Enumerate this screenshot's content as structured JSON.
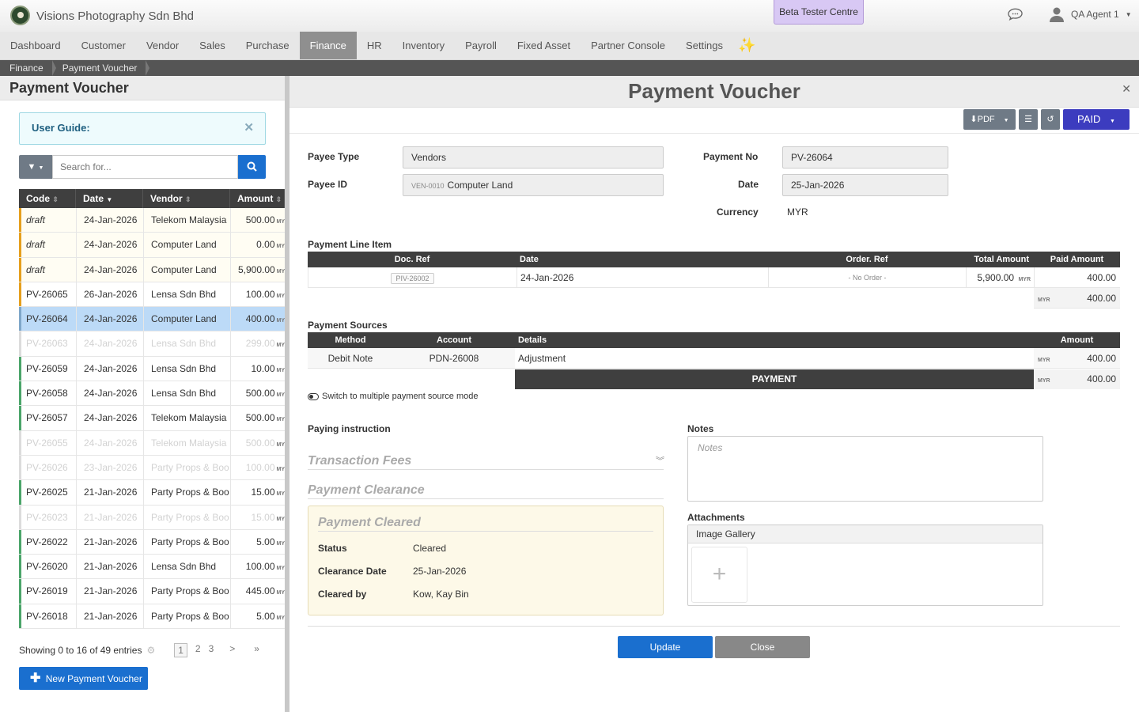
{
  "app": {
    "company": "Visions Photography Sdn Bhd",
    "beta": "Beta Tester Centre",
    "user": "QA Agent 1"
  },
  "nav": [
    "Dashboard",
    "Customer",
    "Vendor",
    "Sales",
    "Purchase",
    "Finance",
    "HR",
    "Inventory",
    "Payroll",
    "Fixed Asset",
    "Partner Console",
    "Settings"
  ],
  "nav_active": "Finance",
  "breadcrumb": [
    "Finance",
    "Payment Voucher"
  ],
  "list": {
    "title": "Payment Voucher",
    "guide": "User Guide:",
    "search_placeholder": "Search for...",
    "columns": [
      "Code",
      "Date",
      "Vendor",
      "Amount"
    ],
    "rows": [
      {
        "code": "draft",
        "date": "24-Jan-2026",
        "vendor": "Telekom Malaysia",
        "amount": "500.00",
        "state": "draft"
      },
      {
        "code": "draft",
        "date": "24-Jan-2026",
        "vendor": "Computer Land",
        "amount": "0.00",
        "state": "draft"
      },
      {
        "code": "draft",
        "date": "24-Jan-2026",
        "vendor": "Computer Land",
        "amount": "5,900.00",
        "state": "draft"
      },
      {
        "code": "PV-26065",
        "date": "26-Jan-2026",
        "vendor": "Lensa Sdn Bhd",
        "amount": "100.00",
        "state": "open"
      },
      {
        "code": "PV-26064",
        "date": "24-Jan-2026",
        "vendor": "Computer Land",
        "amount": "400.00",
        "state": "sel"
      },
      {
        "code": "PV-26063",
        "date": "24-Jan-2026",
        "vendor": "Lensa Sdn Bhd",
        "amount": "299.00",
        "state": "void"
      },
      {
        "code": "PV-26059",
        "date": "24-Jan-2026",
        "vendor": "Lensa Sdn Bhd",
        "amount": "10.00",
        "state": "green"
      },
      {
        "code": "PV-26058",
        "date": "24-Jan-2026",
        "vendor": "Lensa Sdn Bhd",
        "amount": "500.00",
        "state": "green"
      },
      {
        "code": "PV-26057",
        "date": "24-Jan-2026",
        "vendor": "Telekom Malaysia",
        "amount": "500.00",
        "state": "green"
      },
      {
        "code": "PV-26055",
        "date": "24-Jan-2026",
        "vendor": "Telekom Malaysia",
        "amount": "500.00",
        "state": "void"
      },
      {
        "code": "PV-26026",
        "date": "23-Jan-2026",
        "vendor": "Party Props & Boo",
        "amount": "100.00",
        "state": "void"
      },
      {
        "code": "PV-26025",
        "date": "21-Jan-2026",
        "vendor": "Party Props & Boo",
        "amount": "15.00",
        "state": "green"
      },
      {
        "code": "PV-26023",
        "date": "21-Jan-2026",
        "vendor": "Party Props & Boo",
        "amount": "15.00",
        "state": "void"
      },
      {
        "code": "PV-26022",
        "date": "21-Jan-2026",
        "vendor": "Party Props & Boo",
        "amount": "5.00",
        "state": "green"
      },
      {
        "code": "PV-26020",
        "date": "21-Jan-2026",
        "vendor": "Lensa Sdn Bhd",
        "amount": "100.00",
        "state": "green"
      },
      {
        "code": "PV-26019",
        "date": "21-Jan-2026",
        "vendor": "Party Props & Boo",
        "amount": "445.00",
        "state": "green"
      },
      {
        "code": "PV-26018",
        "date": "21-Jan-2026",
        "vendor": "Party Props & Boo",
        "amount": "5.00",
        "state": "green"
      }
    ],
    "currency_short": "MY",
    "showing": "Showing 0 to 16 of 49 entries",
    "pages": [
      "1",
      "2",
      "3",
      ">",
      "»"
    ],
    "new_button": "New Payment Voucher"
  },
  "detail": {
    "title": "Payment Voucher",
    "pdf": "PDF",
    "status": "PAID",
    "payee_type_label": "Payee Type",
    "payee_type": "Vendors",
    "payee_id_label": "Payee ID",
    "payee_code": "VEN-0010",
    "payee_name": "Computer Land",
    "payment_no_label": "Payment No",
    "payment_no": "PV-26064",
    "date_label": "Date",
    "date": "25-Jan-2026",
    "currency_label": "Currency",
    "currency": "MYR",
    "line_title": "Payment Line Item",
    "line_cols": [
      "Doc. Ref",
      "Date",
      "Order. Ref",
      "Total Amount",
      "Paid Amount"
    ],
    "line": {
      "doc": "PIV-26002",
      "date": "24-Jan-2026",
      "order": "- No Order -",
      "total": "5,900.00",
      "cur": "MYR",
      "paid": "400.00"
    },
    "line_total": "400.00",
    "src_title": "Payment Sources",
    "src_cols": [
      "Method",
      "Account",
      "Details",
      "Amount"
    ],
    "src": {
      "method": "Debit Note",
      "account": "PDN-26008",
      "details": "Adjustment",
      "amount": "400.00"
    },
    "payment_label": "PAYMENT",
    "payment_total": "400.00",
    "switch_label": "Switch to multiple payment source mode",
    "paying_instruction": "Paying instruction",
    "notes_label": "Notes",
    "notes_placeholder": "Notes",
    "transaction_fees": "Transaction Fees",
    "payment_clearance": "Payment Clearance",
    "cleared_title": "Payment Cleared",
    "status_label": "Status",
    "status_val": "Cleared",
    "clearance_date_label": "Clearance Date",
    "clearance_date": "25-Jan-2026",
    "cleared_by_label": "Cleared by",
    "cleared_by": "Kow, Kay Bin",
    "attachments": "Attachments",
    "gallery": "Image Gallery",
    "update": "Update",
    "close": "Close"
  }
}
